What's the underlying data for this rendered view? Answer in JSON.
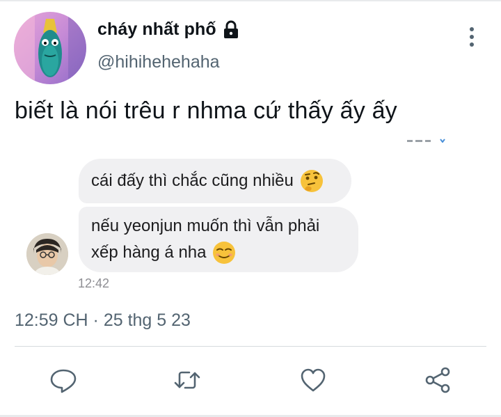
{
  "tweet": {
    "display_name": "cháy nhất phố",
    "handle": "@hihihehehaha",
    "text": "biết là nói trêu r nhma cứ thấy ấy ấy",
    "timestamp": "12:59 CH · 25 thg 5 23"
  },
  "attachment": {
    "messages": [
      {
        "text": "cái đấy thì chắc cũng nhiều",
        "emoji": "thinking-face"
      },
      {
        "lines": [
          "nếu yeonjun muốn thì vẫn phải",
          "xếp hàng á nha"
        ],
        "emoji": "smiling-face"
      }
    ],
    "time": "12:42"
  },
  "actions": [
    "reply-icon",
    "retweet-icon",
    "like-icon",
    "share-icon"
  ],
  "colors": {
    "text": "#0f1419",
    "secondary": "#536471",
    "bubble": "#f0f0f2",
    "divider": "#d6dadd"
  }
}
